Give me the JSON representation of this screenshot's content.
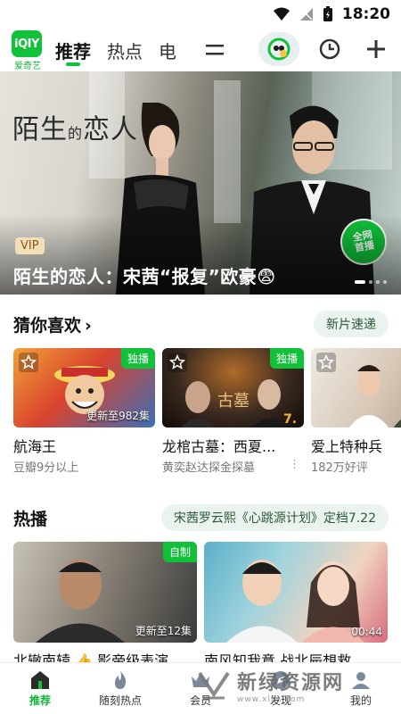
{
  "status_bar": {
    "time": "18:20"
  },
  "logo": {
    "badge": "iQIY",
    "text": "爱奇艺"
  },
  "nav": {
    "tabs": [
      {
        "label": "推荐",
        "active": true
      },
      {
        "label": "热点",
        "active": false
      },
      {
        "label": "电",
        "active": false
      }
    ]
  },
  "banner": {
    "poster_title_a": "陌生",
    "poster_title_small": "的",
    "poster_title_b": "恋人",
    "badge": "全网首播",
    "badge_line1": "全网",
    "badge_line2": "首播",
    "vip": "VIP",
    "caption": "陌生的恋人：宋茜“报复”欧豪😨",
    "dots": 4
  },
  "guess_section": {
    "title": "猜你喜欢",
    "chevron": "›",
    "pill": "新片速递",
    "cards": [
      {
        "title": "航海王",
        "subtitle": "豆瓣9分以上",
        "badge": "独播",
        "update": "更新至982集",
        "colors": [
          "#f3a23a",
          "#d8432e",
          "#3b6fb7"
        ]
      },
      {
        "title": "龙棺古墓：西夏...",
        "subtitle": "黄奕赵达探金探墓",
        "badge": "独播",
        "update": "",
        "colors": [
          "#3a2a20",
          "#7a4a22",
          "#1a1410"
        ]
      },
      {
        "title": "爱上特种兵",
        "subtitle": "182万好评",
        "badge": "",
        "update": "",
        "colors": [
          "#e8e4dc",
          "#c9b6a3",
          "#8c7a6a"
        ]
      }
    ]
  },
  "hot_section": {
    "title": "热播",
    "pill": "宋茜罗云熙《心跳源计划》定档7.22",
    "cards": [
      {
        "badge": "自制",
        "update": "更新至12集",
        "title": "北辙南辕 👍 影帝级表演",
        "colors": [
          "#c7c2b6",
          "#3a3a3a",
          "#8a8378"
        ]
      },
      {
        "badge": "",
        "update": "00:44",
        "title": "南风知我意 战北辰想救",
        "colors": [
          "#5bb0c8",
          "#d96b7c",
          "#f0d4c0"
        ]
      }
    ]
  },
  "bottom_nav": {
    "items": [
      {
        "label": "推荐",
        "icon": "home-icon",
        "active": true
      },
      {
        "label": "随刻热点",
        "icon": "flame-icon",
        "active": false
      },
      {
        "label": "会员",
        "icon": "crown-icon",
        "active": false
      },
      {
        "label": "发现",
        "icon": "compass-icon",
        "active": false
      },
      {
        "label": "我的",
        "icon": "user-icon",
        "active": false
      }
    ]
  },
  "watermark": {
    "text": "新绿资源网",
    "url": "www.xlhs.com"
  },
  "colors": {
    "brand_green": "#10c23a",
    "pill_bg": "#eaf3ee"
  }
}
